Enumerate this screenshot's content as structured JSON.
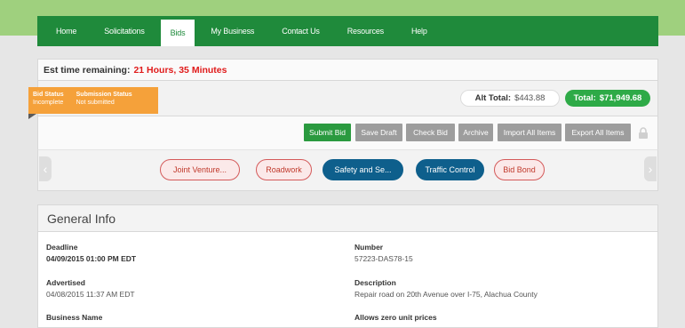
{
  "nav": {
    "items": [
      {
        "label": "Home",
        "active": false
      },
      {
        "label": "Solicitations",
        "active": false
      },
      {
        "label": "Bids",
        "active": true
      },
      {
        "label": "My Business",
        "active": false
      },
      {
        "label": "Contact Us",
        "active": false
      },
      {
        "label": "Resources",
        "active": false
      },
      {
        "label": "Help",
        "active": false
      }
    ]
  },
  "timer": {
    "label": "Est time remaining:",
    "value": "21 Hours, 35 Minutes"
  },
  "status": {
    "bid_status_label": "Bid Status",
    "bid_status_value": "Incomplete",
    "submission_status_label": "Submission Status",
    "submission_status_value": "Not submitted"
  },
  "totals": {
    "alt_label": "Alt Total:",
    "alt_value": "$443.88",
    "total_label": "Total:",
    "total_value": "$71,949.68"
  },
  "toolbar": {
    "submit_bid": "Submit Bid",
    "save_draft": "Save Draft",
    "check_bid": "Check Bid",
    "archive": "Archive",
    "import_all": "Import All Items",
    "export_all": "Export All Items"
  },
  "tags": [
    {
      "label": "Joint Venture...",
      "style": "outline"
    },
    {
      "label": "Roadwork",
      "style": "outline"
    },
    {
      "label": "Safety and Se...",
      "style": "filled"
    },
    {
      "label": "Traffic Control",
      "style": "filled"
    },
    {
      "label": "Bid Bond",
      "style": "outline"
    }
  ],
  "general": {
    "title": "General Info",
    "deadline_label": "Deadline",
    "deadline_value": "04/09/2015 01:00 PM EDT",
    "number_label": "Number",
    "number_value": "57223-DAS78-15",
    "advertised_label": "Advertised",
    "advertised_value": "04/08/2015 11:37 AM EDT",
    "description_label": "Description",
    "description_value": "Repair road on 20th Avenue over I-75, Alachua County",
    "business_name_label": "Business Name",
    "allows_zero_label": "Allows zero unit prices"
  },
  "colors": {
    "nav_green": "#1f8a3b",
    "total_green": "#2eaa47",
    "status_orange": "#f5a13a",
    "timer_red": "#e01b1b",
    "tag_blue": "#0e5f8c"
  },
  "icons": {
    "lock": "lock-icon",
    "left_arrow": "chevron-left-icon",
    "right_arrow": "chevron-right-icon"
  }
}
